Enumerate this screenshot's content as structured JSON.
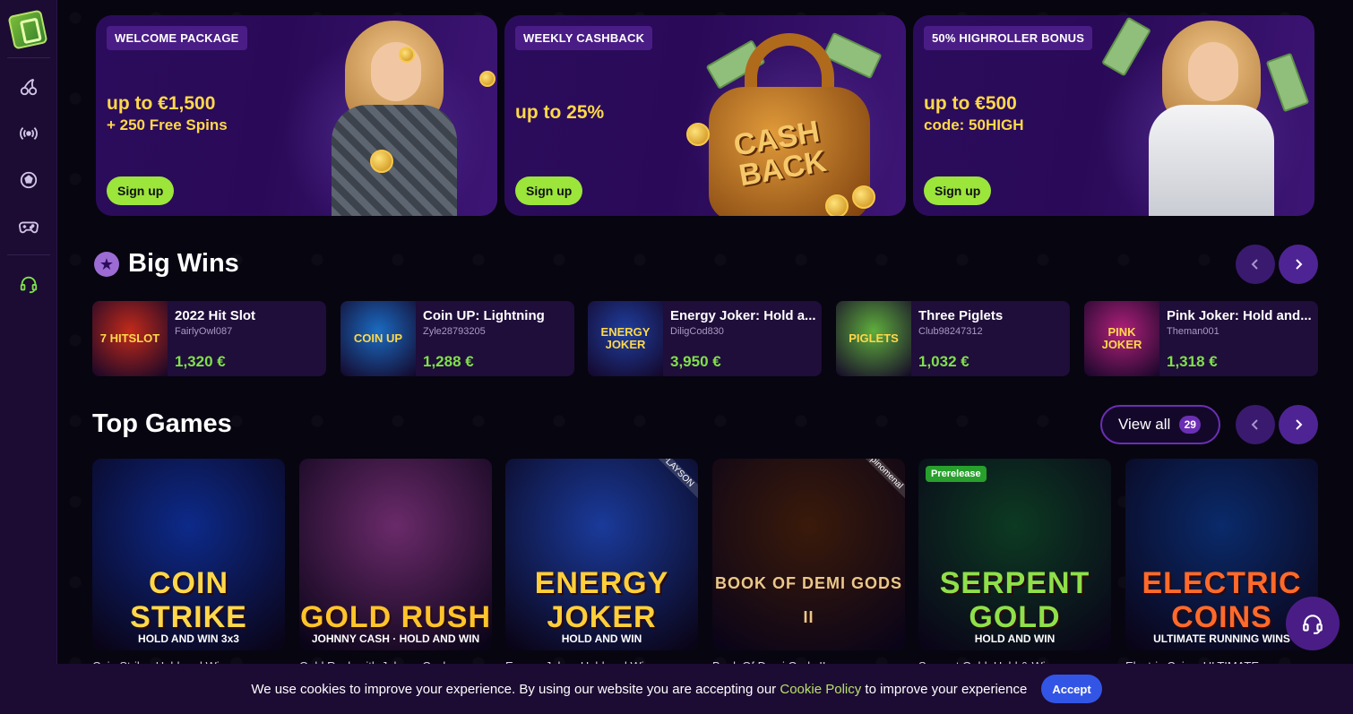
{
  "sidebar": {
    "icons": [
      "cherries-icon",
      "live-broadcast-icon",
      "football-icon",
      "gamepad-icon",
      "headset-icon"
    ]
  },
  "promos": [
    {
      "badge": "WELCOME PACKAGE",
      "line1": "up to €1,500",
      "line2": "+ 250 Free Spins",
      "button": "Sign up"
    },
    {
      "badge": "WEEKLY CASHBACK",
      "line1": "up to 25%",
      "line2": "",
      "button": "Sign up",
      "art_text": "CASH BACK"
    },
    {
      "badge": "50% HIGHROLLER BONUS",
      "line1": "up to €500",
      "line2": "code: 50HIGH",
      "button": "Sign up"
    }
  ],
  "big_wins": {
    "title": "Big Wins",
    "items": [
      {
        "game": "2022 Hit Slot",
        "user": "FairlyOwl087",
        "amount": "1,320 €",
        "thumb_text": "7 HITSLOT",
        "color": "#c22a1a"
      },
      {
        "game": "Coin UP: Lightning",
        "user": "Zyle28793205",
        "amount": "1,288 €",
        "thumb_text": "COIN UP",
        "color": "#1a6bc2"
      },
      {
        "game": "Energy Joker: Hold a...",
        "user": "DiligCod830",
        "amount": "3,950 €",
        "thumb_text": "ENERGY JOKER",
        "color": "#1f3fa0"
      },
      {
        "game": "Three Piglets",
        "user": "Club98247312",
        "amount": "1,032 €",
        "thumb_text": "PIGLETS",
        "color": "#5fae3c"
      },
      {
        "game": "Pink Joker: Hold and...",
        "user": "Theman001",
        "amount": "1,318 €",
        "thumb_text": "PINK JOKER",
        "color": "#b0207a"
      }
    ]
  },
  "top_games": {
    "title": "Top Games",
    "view_all": "View all",
    "count": "29",
    "items": [
      {
        "title": "COIN STRIKE",
        "sub": "HOLD AND WIN 3x3",
        "caption": "Coin Strike: Hold and Win",
        "bg": "#0d2a8a",
        "fg": "#ffd84a",
        "tag": "",
        "prerelease": ""
      },
      {
        "title": "GOLD RUSH",
        "sub": "JOHNNY CASH · HOLD AND WIN",
        "caption": "Gold Rush with Johnny Cash",
        "bg": "#6a2a6a",
        "fg": "#ffc42a",
        "tag": "",
        "prerelease": ""
      },
      {
        "title": "ENERGY JOKER",
        "sub": "HOLD AND WIN",
        "caption": "Energy Joker: Hold and Win",
        "bg": "#1a3a9a",
        "fg": "#ffcf3a",
        "tag": "PLAYSON",
        "prerelease": ""
      },
      {
        "title": "BOOK OF DEMI GODS II",
        "sub": "",
        "caption": "Book Of Demi Gods II",
        "bg": "#3a1a0a",
        "fg": "#e8c98a",
        "tag": "Spinomenal",
        "prerelease": ""
      },
      {
        "title": "SERPENT GOLD",
        "sub": "HOLD AND WIN",
        "caption": "Serpent Gold: Hold & Win",
        "bg": "#0c3a22",
        "fg": "#8fe04a",
        "tag": "",
        "prerelease": "Prerelease"
      },
      {
        "title": "ELECTRIC COINS",
        "sub": "ULTIMATE RUNNING WINS",
        "caption": "Electric Coins: ULTIMATE",
        "bg": "#0a2a6a",
        "fg": "#ff6a2a",
        "tag": "",
        "prerelease": ""
      }
    ]
  },
  "cookie": {
    "text_before": "We use cookies to improve your experience. By using our website you are accepting our ",
    "link": "Cookie Policy",
    "text_after": " to improve your experience",
    "button": "Accept"
  }
}
